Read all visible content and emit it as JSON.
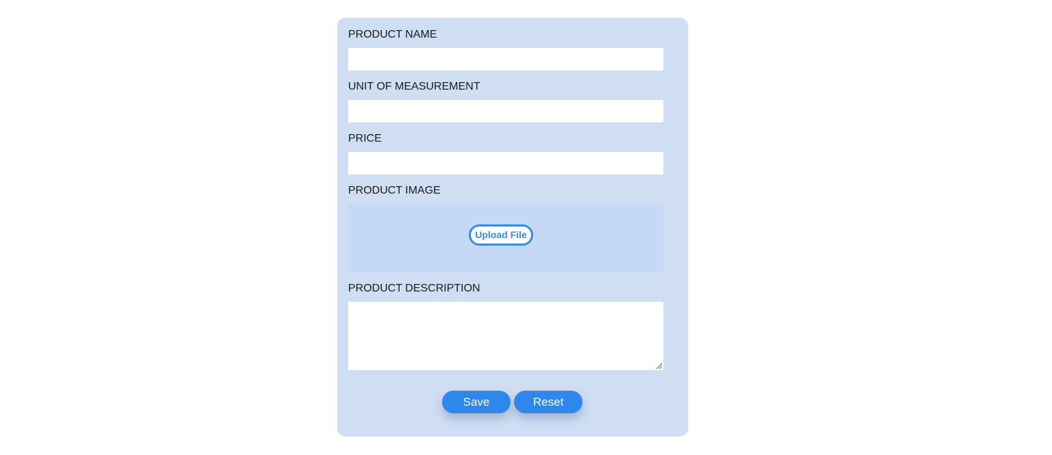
{
  "form": {
    "fields": {
      "product_name": {
        "label": "PRODUCT NAME",
        "value": ""
      },
      "unit_of_measurement": {
        "label": "UNIT OF MEASUREMENT",
        "value": ""
      },
      "price": {
        "label": "PRICE",
        "value": ""
      },
      "product_image": {
        "label": "PRODUCT IMAGE",
        "upload_label": "Upload File"
      },
      "product_description": {
        "label": "PRODUCT DESCRIPTION",
        "value": ""
      }
    },
    "actions": {
      "save_label": "Save",
      "reset_label": "Reset"
    }
  },
  "colors": {
    "page_background": "#ffffff",
    "card_background": "#d0def4",
    "upload_zone_background": "#c5d8f5",
    "accent": "#2f87ec",
    "upload_border": "#3a89e6"
  }
}
